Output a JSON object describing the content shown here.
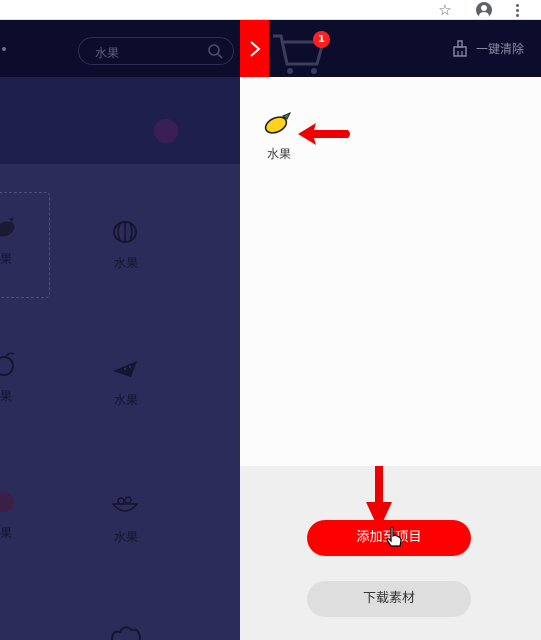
{
  "browser": {
    "icons": [
      "star-icon",
      "account-icon",
      "more-vert-icon"
    ]
  },
  "site": {
    "search": {
      "value": "水果"
    },
    "grid": [
      {
        "label": "果",
        "icon": "mango-icon"
      },
      {
        "label": "水果",
        "icon": "durian-icon"
      },
      {
        "label": "果",
        "icon": "fruit-icon"
      },
      {
        "label": "水果",
        "icon": "watermelon-icon"
      },
      {
        "label": "果",
        "icon": "fruit-icon"
      },
      {
        "label": "水果",
        "icon": "fruit-bowl-icon"
      }
    ]
  },
  "cart": {
    "count": "1",
    "clear_all_label": "一键清除",
    "items": [
      {
        "label": "水果",
        "icon": "mango-icon"
      }
    ],
    "add_button_label": "添加至项目",
    "download_button_label": "下载素材"
  },
  "colors": {
    "accent": "#ff0000",
    "header_bg": "#0c0c2c",
    "overlay_bg": "#2c2c5a"
  }
}
